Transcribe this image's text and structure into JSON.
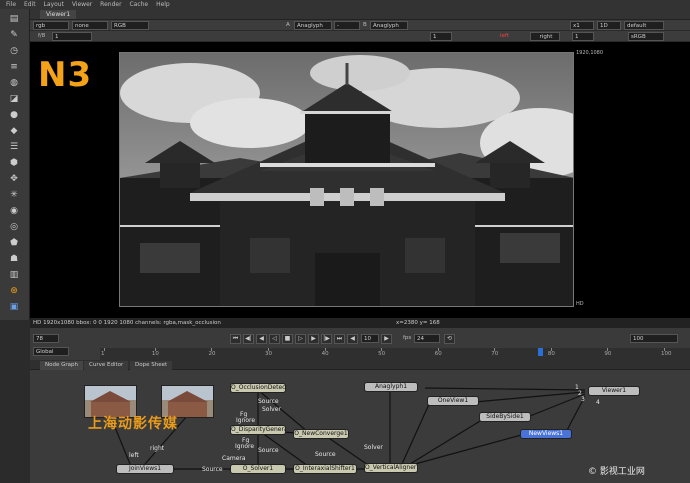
{
  "menu": [
    "File",
    "Edit",
    "Layout",
    "Viewer",
    "Render",
    "Cache",
    "Help"
  ],
  "viewer_tab": "Viewer1",
  "controls_row1": {
    "channels": "rgb",
    "layer": "none",
    "display": "RGB",
    "a_label": "A",
    "a_input": "Anaglyph",
    "wipe": "-",
    "b_label": "B",
    "b_input": "Anaglyph",
    "zoom": "x1",
    "proxy": "1D",
    "lut": "default"
  },
  "controls_row2": {
    "fstop_label": "f/8",
    "fstop_value": "1",
    "ip_value": "1",
    "view_left": "left",
    "view_right": "right",
    "frame_value": "1",
    "colorspace": "sRGB"
  },
  "viewport": {
    "overlay_text": "N3",
    "format_top": "1920,1080",
    "format_bottom": "HD"
  },
  "infobar": {
    "left": "HD 1920x1080  bbox: 0 0 1920 1080  channels: rgba,mask_occlusion",
    "coords": "x=2380 y= 168"
  },
  "playback": {
    "frame_field": "78",
    "range_mode": "Global",
    "step": "10",
    "fps_label": "fps",
    "fps_value": "24",
    "current_frame": "100",
    "timeline_ticks": [
      "1",
      "10",
      "20",
      "30",
      "40",
      "50",
      "60",
      "70",
      "80",
      "90",
      "100"
    ],
    "playhead_frame": 78
  },
  "node_graph": {
    "tabs": [
      "Node Graph",
      "Curve Editor",
      "Dope Sheet"
    ],
    "watermark": "上海动影传媒",
    "nodes": {
      "left_read": "left",
      "right_read": "right",
      "joinviews": "JoinViews1",
      "occlusion": "O_OcclusionDetector1",
      "disparity": "O_DisparityGenerator1",
      "solver": "O_Solver1",
      "converge": "O_NewConverge1",
      "interaxial": "O_InteraxialShifter1",
      "vertical": "O_VerticalAligner1",
      "anaglyph": "Anaglyph1",
      "oneview": "OneView1",
      "sidebyside": "SideBySide1",
      "newviews": "NewViews1",
      "viewer": "Viewer1"
    },
    "edge_labels": {
      "source1": "Source",
      "solver1": "Solver",
      "fg": "Fg",
      "ignore": "Ignore",
      "fg2": "Fg",
      "source2": "Source",
      "ignore2": "Ignore",
      "source3": "Source",
      "camera": "Camera",
      "source_join": "Source",
      "solver2": "Solver",
      "left_lbl": "left",
      "right_lbl": "right",
      "n1": "1",
      "n2": "2",
      "n3": "3",
      "n4": "4"
    }
  },
  "credit": "© 影视工业网",
  "colors": {
    "accent": "#f3a21a",
    "playhead": "#2a6fd6",
    "selected_node": "#4a73d8"
  }
}
